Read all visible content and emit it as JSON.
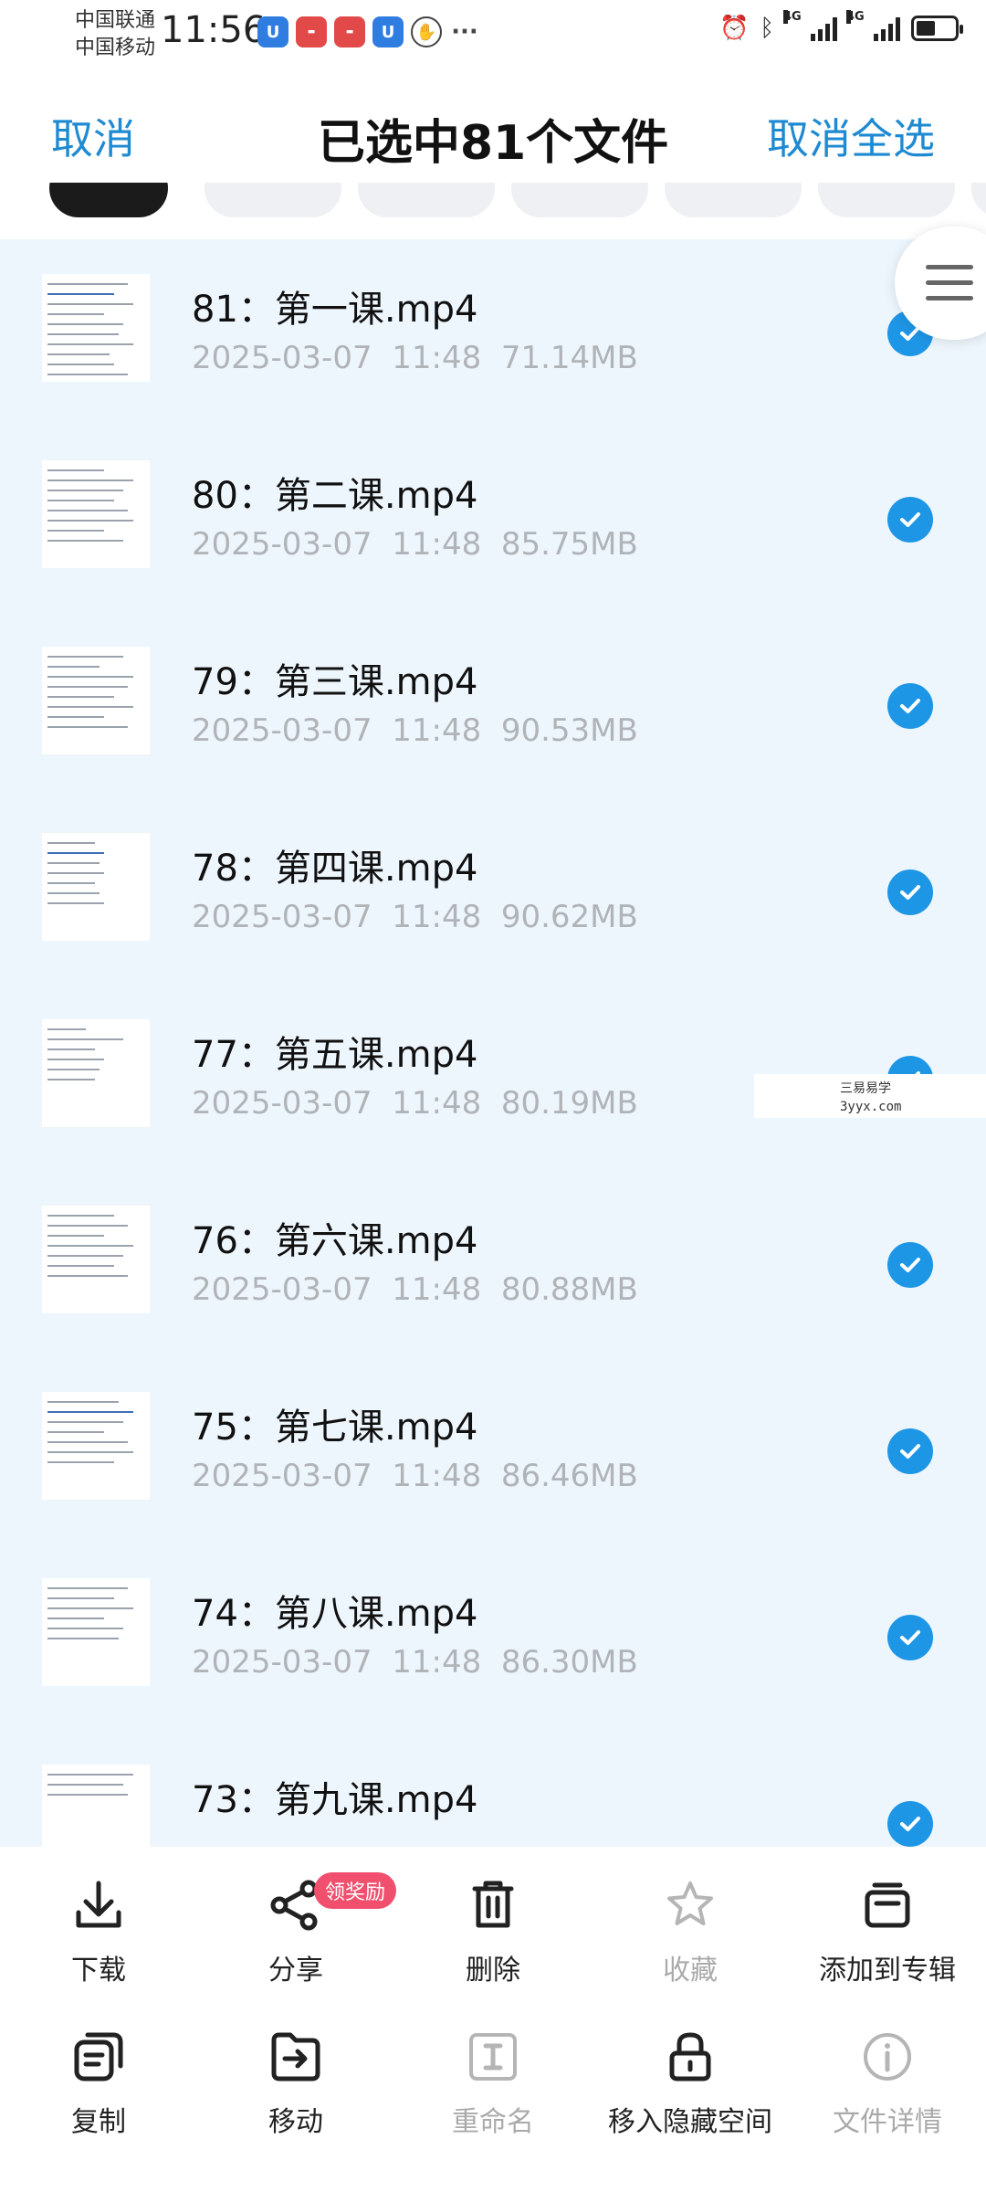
{
  "status_bar": {
    "carrier1": "中国联通",
    "carrier2": "中国移动",
    "time": "11:56",
    "signal1_label": "4G",
    "signal2_label": "4G"
  },
  "header": {
    "cancel_label": "取消",
    "title": "已选中81个文件",
    "deselect_all_label": "取消全选"
  },
  "files": [
    {
      "name": "81：第一课.mp4",
      "date": "2025-03-07",
      "time": "11:48",
      "size": "71.14MB",
      "selected": true
    },
    {
      "name": "80：第二课.mp4",
      "date": "2025-03-07",
      "time": "11:48",
      "size": "85.75MB",
      "selected": true
    },
    {
      "name": "79：第三课.mp4",
      "date": "2025-03-07",
      "time": "11:48",
      "size": "90.53MB",
      "selected": true
    },
    {
      "name": "78：第四课.mp4",
      "date": "2025-03-07",
      "time": "11:48",
      "size": "90.62MB",
      "selected": true
    },
    {
      "name": "77：第五课.mp4",
      "date": "2025-03-07",
      "time": "11:48",
      "size": "80.19MB",
      "selected": true
    },
    {
      "name": "76：第六课.mp4",
      "date": "2025-03-07",
      "time": "11:48",
      "size": "80.88MB",
      "selected": true
    },
    {
      "name": "75：第七课.mp4",
      "date": "2025-03-07",
      "time": "11:48",
      "size": "86.46MB",
      "selected": true
    },
    {
      "name": "74：第八课.mp4",
      "date": "2025-03-07",
      "time": "11:48",
      "size": "86.30MB",
      "selected": true
    },
    {
      "name": "73：第九课.mp4",
      "date": "",
      "time": "",
      "size": "",
      "selected": true
    }
  ],
  "watermark": {
    "line1": "三易易学",
    "line2": "3yyx.com"
  },
  "actions": {
    "download": "下载",
    "share": "分享",
    "share_badge": "领奖励",
    "delete": "删除",
    "favorite": "收藏",
    "add_to_album": "添加到专辑",
    "copy": "复制",
    "move": "移动",
    "rename": "重命名",
    "move_to_hidden": "移入隐藏空间",
    "file_details": "文件详情"
  },
  "colors": {
    "accent": "#1e8ad2",
    "check": "#1e96e6",
    "list_bg": "#eef6fd",
    "badge": "#f0506e"
  }
}
